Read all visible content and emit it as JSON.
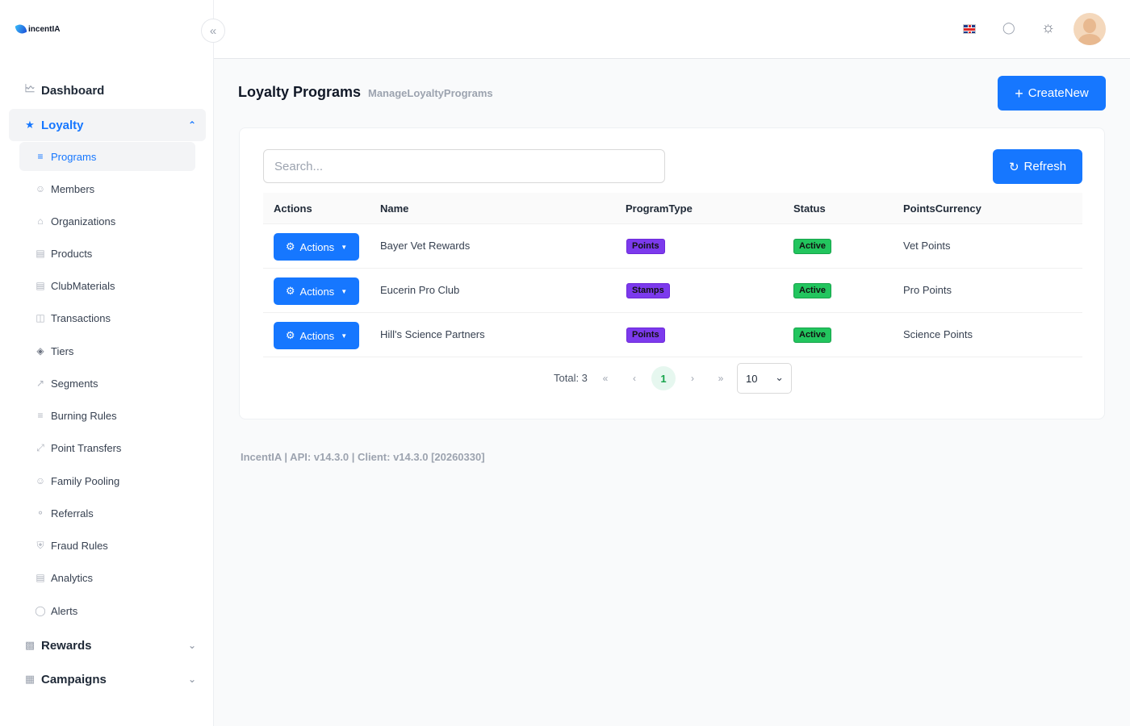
{
  "brand": {
    "name": "incentIA"
  },
  "sidebar": {
    "top_items": [
      {
        "label": "Dashboard",
        "icon": "chart-icon"
      },
      {
        "label": "Loyalty",
        "icon": "star-icon"
      },
      {
        "label": "Rewards",
        "icon": "gift-icon"
      },
      {
        "label": "Campaigns",
        "icon": "calendar-icon"
      }
    ],
    "loyalty_items": [
      {
        "label": "Programs",
        "icon": "list-check-icon"
      },
      {
        "label": "Members",
        "icon": "users-icon"
      },
      {
        "label": "Organizations",
        "icon": "home-icon"
      },
      {
        "label": "Products",
        "icon": "file-icon"
      },
      {
        "label": "ClubMaterials",
        "icon": "document-icon"
      },
      {
        "label": "Transactions",
        "icon": "database-icon"
      },
      {
        "label": "Tiers",
        "icon": "layers-icon"
      },
      {
        "label": "Segments",
        "icon": "trend-icon"
      },
      {
        "label": "Burning Rules",
        "icon": "list-check-icon"
      },
      {
        "label": "Point Transfers",
        "icon": "expand-icon"
      },
      {
        "label": "Family Pooling",
        "icon": "users-icon"
      },
      {
        "label": "Referrals",
        "icon": "share-icon"
      },
      {
        "label": "Fraud Rules",
        "icon": "shield-icon"
      },
      {
        "label": "Analytics",
        "icon": "chart-icon"
      },
      {
        "label": "Alerts",
        "icon": "bell-icon"
      }
    ]
  },
  "header": {
    "language": "en-GB",
    "theme": "light"
  },
  "main": {
    "title": "Loyalty Programs",
    "subtitle": "ManageLoyaltyPrograms",
    "create_label": "CreateNew",
    "search_placeholder": "Search...",
    "refresh_label": "Refresh",
    "columns": [
      "Actions",
      "Name",
      "ProgramType",
      "Status",
      "PointsCurrency"
    ],
    "rows": [
      {
        "action": "Actions",
        "name": "Bayer Vet Rewards",
        "type": "Points",
        "status": "Active",
        "currency": "Vet Points"
      },
      {
        "action": "Actions",
        "name": "Eucerin Pro Club",
        "type": "Stamps",
        "status": "Active",
        "currency": "Pro Points"
      },
      {
        "action": "Actions",
        "name": "Hill's Science Partners",
        "type": "Points",
        "status": "Active",
        "currency": "Science Points"
      }
    ],
    "pagination": {
      "total_label": "Total: 3",
      "current_page": "1",
      "page_size": "10"
    }
  },
  "footer": {
    "text": "IncentIA | API: v14.3.0 | Client: v14.3.0 [20260330]"
  },
  "colors": {
    "primary": "#1677ff",
    "badge_purple": "#7c3aed",
    "badge_green": "#22c55e"
  }
}
